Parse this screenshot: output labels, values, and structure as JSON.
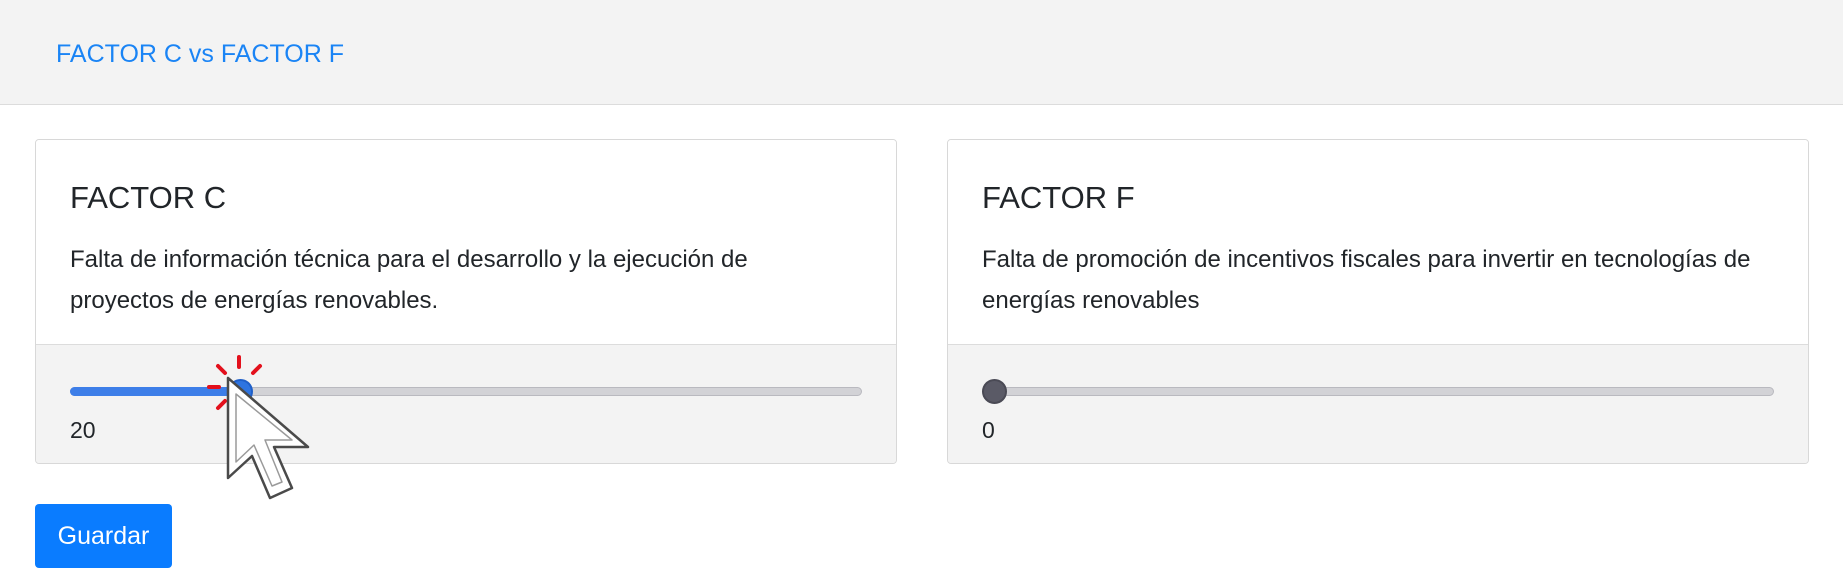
{
  "header": {
    "title": "FACTOR C vs FACTOR F"
  },
  "cards": [
    {
      "heading": "FACTOR C",
      "description": "Falta de información técnica para el desarrollo y la ejecución de proyectos de energías renovables.",
      "slider_value": 20,
      "slider_label": "20",
      "slider_max": 100,
      "slider_state": "active",
      "accent_color": "#3d7ee8"
    },
    {
      "heading": "FACTOR F",
      "description": "Falta de promoción de incentivos fiscales para invertir en tecnologías de energías renovables",
      "slider_value": 0,
      "slider_label": "0",
      "slider_max": 100,
      "slider_state": "idle",
      "accent_color": "#5a5a66"
    }
  ],
  "actions": {
    "save_label": "Guardar",
    "save_color": "#0a7cff"
  },
  "overlay": {
    "cursor_icon": "hand-pointer-arrow-icon",
    "click_icon": "click-burst-icon",
    "click_color": "#e3101c"
  }
}
